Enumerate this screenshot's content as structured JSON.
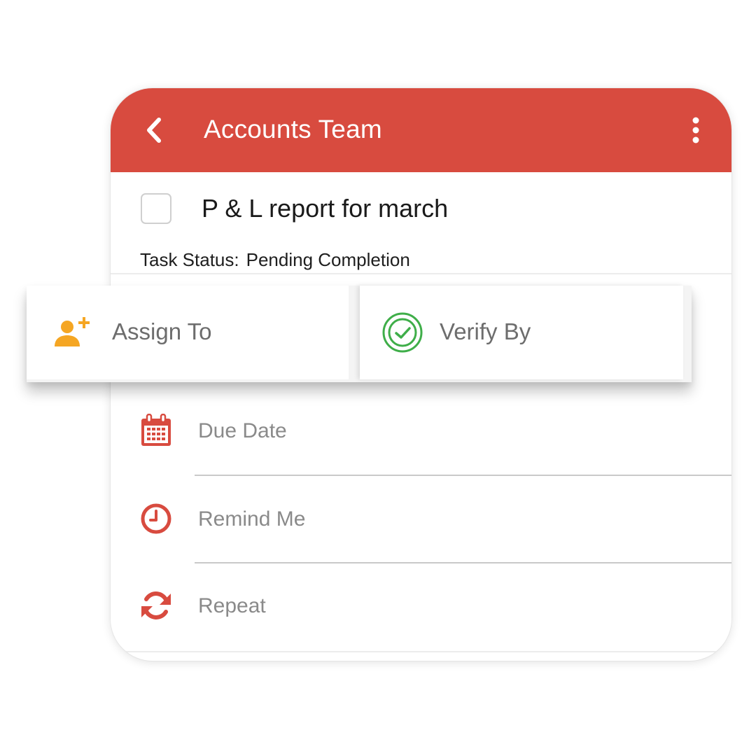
{
  "header": {
    "back_icon": "chevron-left-icon",
    "title": "Accounts Team",
    "menu_icon": "more-vertical-icon",
    "background": "#d84b3f"
  },
  "task": {
    "title": "P & L report for march",
    "checked": false,
    "status_label": "Task Status:",
    "status_value": "Pending Completion"
  },
  "actions": {
    "assign": {
      "label": "Assign To",
      "icon": "add-person-icon",
      "color": "#f5a623"
    },
    "verify": {
      "label": "Verify By",
      "icon": "verified-check-icon",
      "color": "#3fae49"
    }
  },
  "fields": [
    {
      "label": "Due Date",
      "icon": "calendar-icon"
    },
    {
      "label": "Remind Me",
      "icon": "clock-icon"
    },
    {
      "label": "Repeat",
      "icon": "repeat-icon"
    }
  ],
  "colors": {
    "accent": "#d84b3f",
    "field_icon": "#d84b3f"
  }
}
